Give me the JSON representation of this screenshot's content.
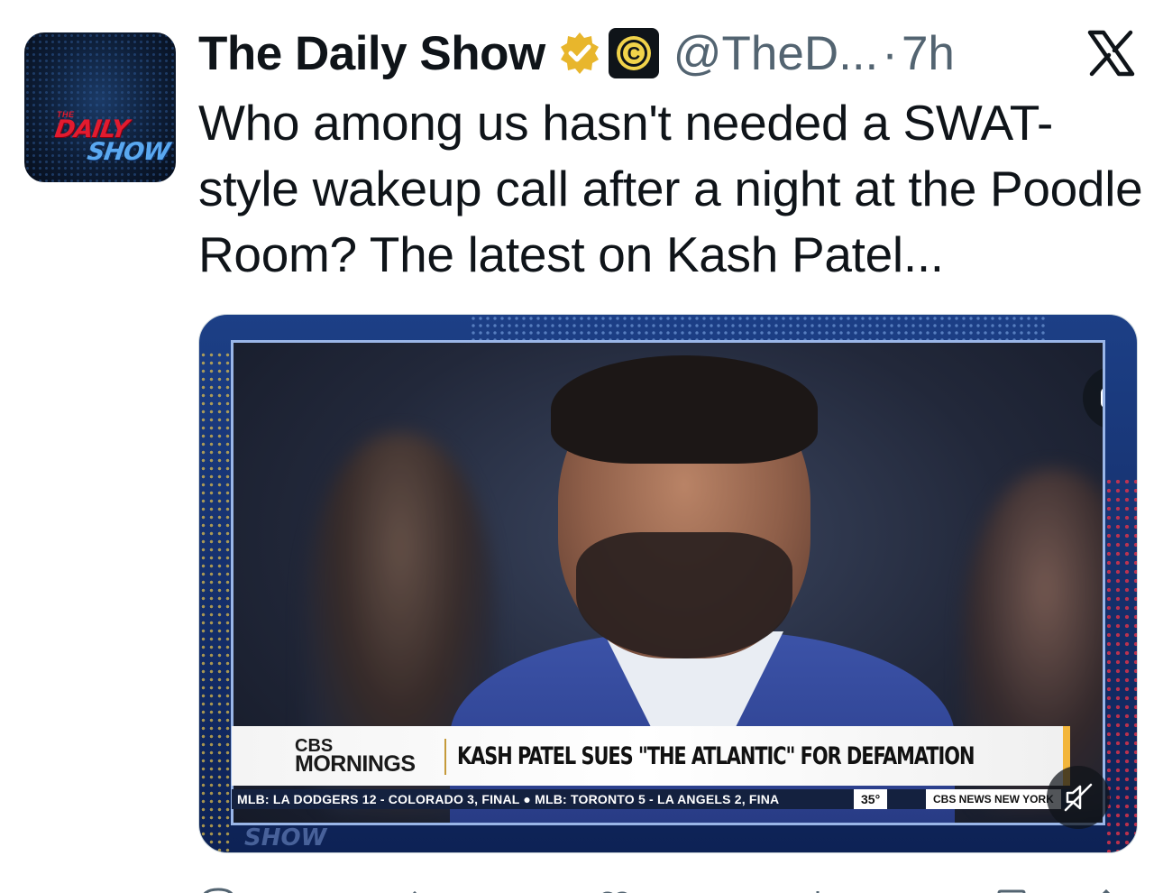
{
  "tweet": {
    "display_name": "The Daily Show",
    "handle": "@TheD...",
    "separator": "·",
    "time": "7h",
    "text": "Who among us hasn't needed a SWAT-style wakeup call after a night at the Poodle Room? The latest on Kash Patel..."
  },
  "avatar": {
    "small": "THE",
    "line1": "DAILY",
    "line2": "SHOW"
  },
  "video": {
    "cc_label": "CC",
    "network": "CBS",
    "program": "MORNINGS",
    "headline": "KASH PATEL SUES \"THE ATLANTIC\" FOR DEFAMATION",
    "ticker": "MLB: LA DODGERS 12 - COLORADO 3, FINAL  ●  MLB: TORONTO 5 - LA ANGELS 2, FINA",
    "temperature": "35°",
    "news_label": "CBS NEWS NEW YORK",
    "watermark": "SHOW"
  },
  "colors": {
    "verified_gold": "#e8b62c",
    "text_primary": "#0f1419",
    "text_secondary": "#536471",
    "media_blue": "#1c3f86",
    "headline_accent": "#f3b63b"
  },
  "icons": [
    "verified-gold-badge-icon",
    "comedy-central-badge-icon",
    "x-logo-icon",
    "closed-captions-icon",
    "mute-icon",
    "reply-icon",
    "repost-icon",
    "like-icon",
    "views-icon",
    "bookmark-icon",
    "share-icon"
  ]
}
